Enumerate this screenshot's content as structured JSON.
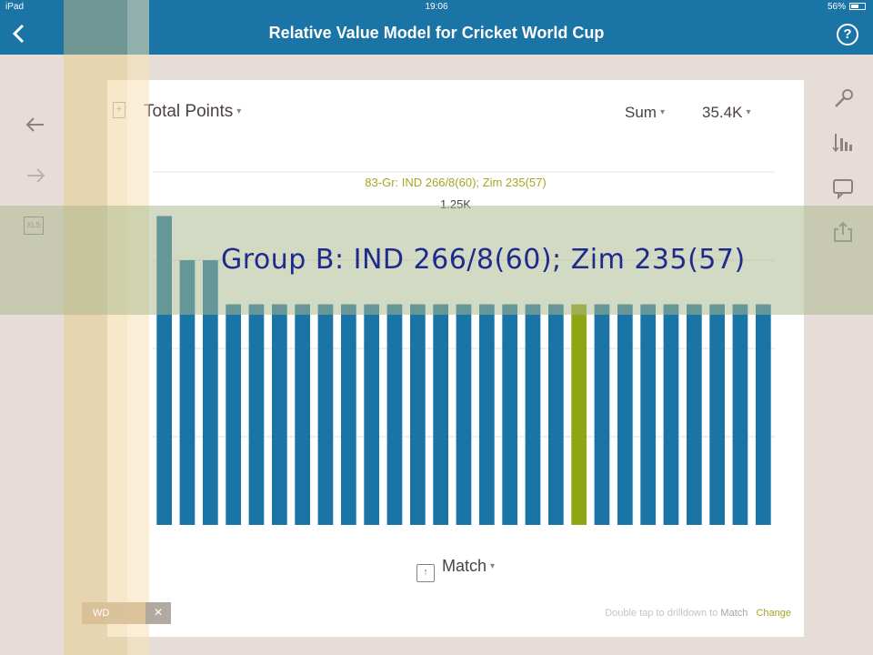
{
  "status_bar": {
    "device": "iPad",
    "time": "19:06",
    "battery": "56%"
  },
  "nav": {
    "title": "Relative Value Model for Cricket World Cup",
    "back_icon": "chevron-left-icon",
    "help_icon": "question-circle-icon"
  },
  "left_toolbar": [
    "arrow-left-icon",
    "arrow-right-icon",
    "xls-export-icon"
  ],
  "right_toolbar": [
    "wrench-icon",
    "sort-icon",
    "comment-icon",
    "share-icon"
  ],
  "chart_header": {
    "measure": "Total Points",
    "aggregation": "Sum",
    "total": "35.4K"
  },
  "selection": {
    "label": "83-Gr: IND 266/8(60); Zim 235(57)",
    "value": "1.25K"
  },
  "dimension": {
    "label": "Match"
  },
  "hint": {
    "text": "Double tap to drilldown to",
    "dimension": "Match",
    "action": "Change"
  },
  "annotation": "Group B: IND 266/8(60); Zim 235(57)",
  "bottom_chip": {
    "label": "WD",
    "close": "×"
  },
  "colors": {
    "accent": "#1a74a6",
    "bar": "#1a74a6",
    "highlight": "#8ea614"
  },
  "chart_data": {
    "type": "bar",
    "values": [
      1.75,
      1.5,
      1.5,
      1.25,
      1.25,
      1.25,
      1.25,
      1.25,
      1.25,
      1.25,
      1.25,
      1.25,
      1.25,
      1.25,
      1.25,
      1.25,
      1.25,
      1.25,
      1.25,
      1.25,
      1.25,
      1.25,
      1.25,
      1.25,
      1.25,
      1.25,
      1.25
    ],
    "highlight_index": 18,
    "unit": "K",
    "ylim": [
      0,
      2.0
    ],
    "grid": true
  }
}
